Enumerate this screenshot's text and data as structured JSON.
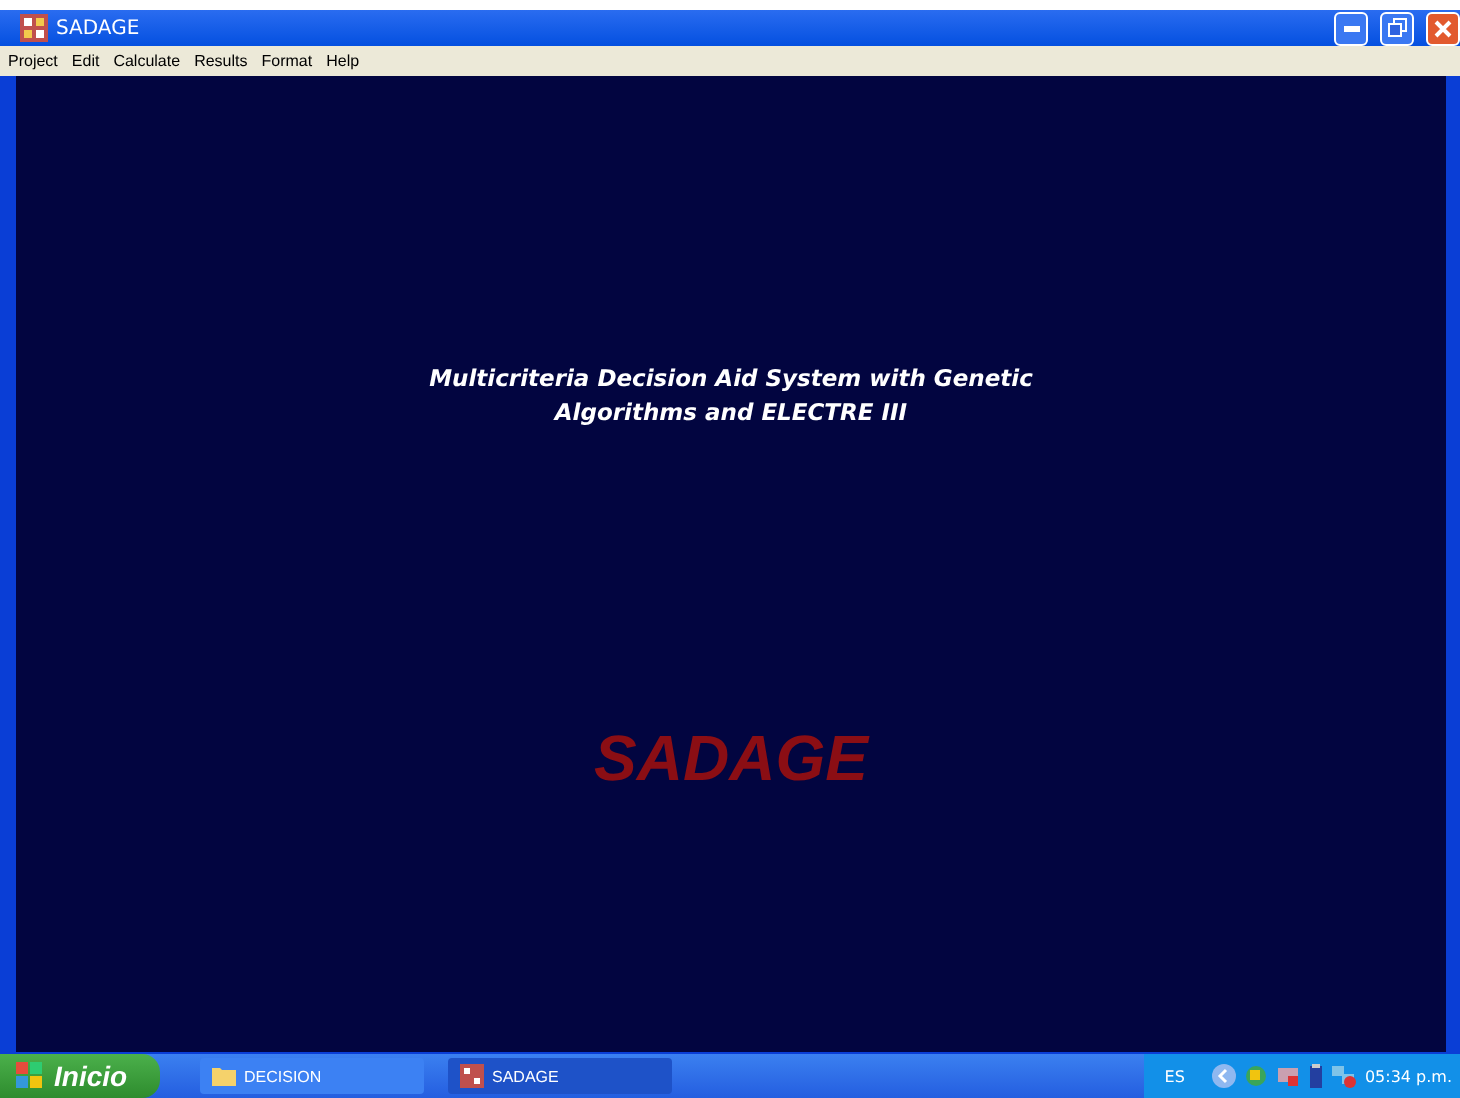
{
  "window": {
    "title": "SADAGE"
  },
  "menu": [
    "Project",
    "Edit",
    "Calculate",
    "Results",
    "Format",
    "Help"
  ],
  "content": {
    "heading": "Multicriteria Decision Aid System with Genetic Algorithms and ELECTRE III",
    "logo_text": "SADAGE"
  },
  "taskbar": {
    "start": "Inicio",
    "tasks": [
      {
        "label": "DECISION",
        "kind": "folder",
        "selected": false
      },
      {
        "label": "SADAGE",
        "kind": "app",
        "selected": true
      }
    ],
    "language": "ES",
    "clock": "05:34 p.m."
  }
}
